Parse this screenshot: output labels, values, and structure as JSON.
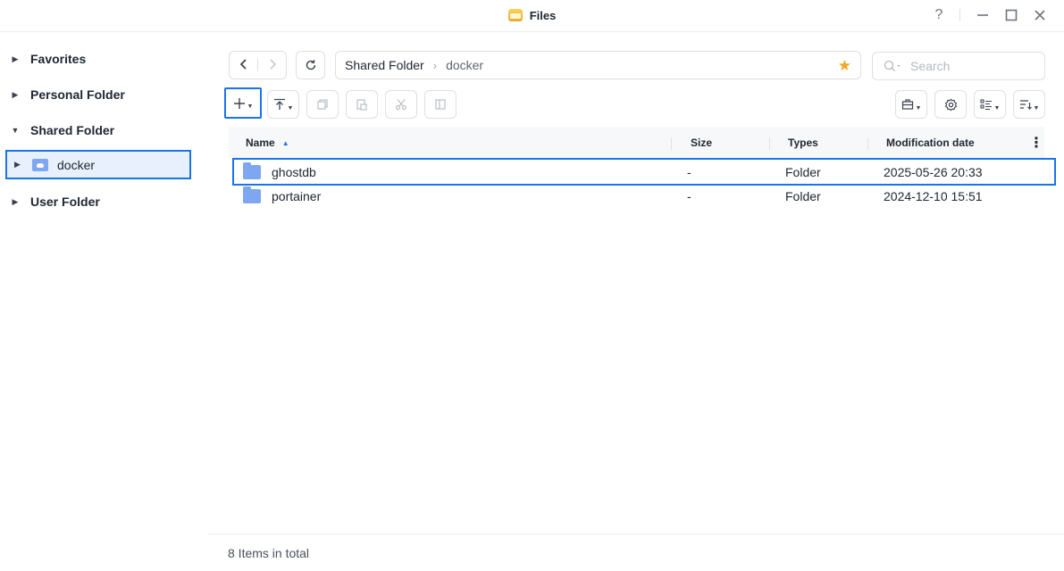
{
  "window": {
    "title": "Files",
    "controls": [
      "help-icon",
      "minimize-icon",
      "maximize-icon",
      "close-icon"
    ],
    "help_glyph": "?"
  },
  "sidebar": {
    "items": [
      {
        "label": "Favorites"
      },
      {
        "label": "Personal Folder"
      },
      {
        "label": "Shared Folder",
        "expanded": true
      },
      {
        "label": "User Folder"
      }
    ],
    "child": {
      "label": "docker",
      "selected": true
    }
  },
  "toolbar": {
    "back_icon": "chevron-left-icon",
    "forward_icon": "chevron-right-icon",
    "refresh_icon": "refresh-icon",
    "new_icon": "plus-icon",
    "upload_icon": "upload-icon",
    "copy_icon": "copy-icon",
    "paste_icon": "paste-icon",
    "cut_icon": "scissors-icon",
    "rename_icon": "rename-icon",
    "tools_icon": "toolbox-icon",
    "settings_icon": "gear-icon",
    "view_icon": "list-view-icon",
    "sort_icon": "sort-icon"
  },
  "path": {
    "root": "Shared Folder",
    "current": "docker",
    "favorite_color": "#f5a623"
  },
  "search": {
    "placeholder": "Search"
  },
  "table": {
    "columns": [
      "Name",
      "Size",
      "Types",
      "Modification date"
    ],
    "sort_column": "Name",
    "sort_direction": "ascending",
    "rows": [
      {
        "name": "ghostdb",
        "size": "-",
        "type": "Folder",
        "modified": "2025-05-26 20:33",
        "selected": true
      },
      {
        "name": "portainer",
        "size": "-",
        "type": "Folder",
        "modified": "2024-12-10 15:51",
        "selected": false
      }
    ]
  },
  "status": {
    "items_total": "8 Items in total"
  },
  "colors": {
    "accent": "#1a73e8",
    "folder": "#7ea6f1",
    "star": "#f5a623"
  }
}
